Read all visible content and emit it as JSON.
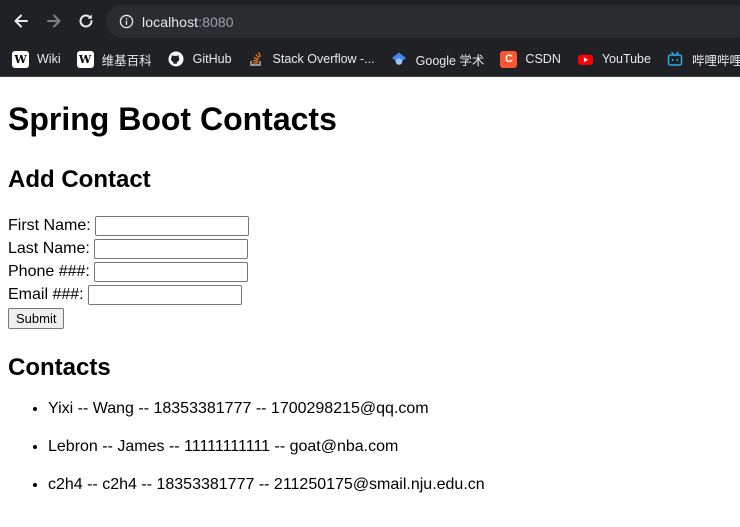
{
  "browser": {
    "url_host": "localhost",
    "url_port": ":8080",
    "bookmarks": [
      {
        "label": "Wiki",
        "icon": "wikipedia-icon"
      },
      {
        "label": "维基百科",
        "icon": "wikipedia-icon"
      },
      {
        "label": "GitHub",
        "icon": "github-icon"
      },
      {
        "label": "Stack Overflow -...",
        "icon": "stackoverflow-icon"
      },
      {
        "label": "Google 学术",
        "icon": "google-scholar-icon"
      },
      {
        "label": "CSDN",
        "icon": "csdn-icon"
      },
      {
        "label": "YouTube",
        "icon": "youtube-icon"
      },
      {
        "label": "哔哩哔哩",
        "icon": "bilibili-icon"
      }
    ]
  },
  "page": {
    "title": "Spring Boot Contacts",
    "add_heading": "Add Contact",
    "form": {
      "first_name_label": "First Name:",
      "last_name_label": "Last Name:",
      "phone_label": "Phone ###:",
      "email_label": "Email ###:",
      "first_name_value": "",
      "last_name_value": "",
      "phone_value": "",
      "email_value": "",
      "submit_label": "Submit"
    },
    "contacts_heading": "Contacts",
    "contacts": [
      "Yixi -- Wang -- 18353381777 -- 1700298215@qq.com",
      "Lebron -- James -- 11111111111 -- goat@nba.com",
      "c2h4 -- c2h4 -- 18353381777 -- 211250175@smail.nju.edu.cn"
    ]
  }
}
